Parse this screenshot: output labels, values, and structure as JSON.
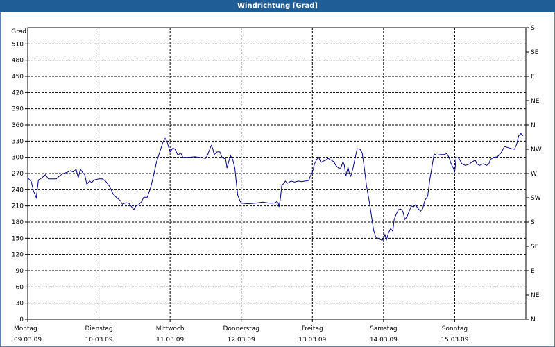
{
  "window": {
    "title": "Windrichtung [Grad]"
  },
  "chart_data": {
    "type": "line",
    "title": "Windrichtung [Grad]",
    "ylabel": "Grad",
    "ylim": [
      0,
      540
    ],
    "yticks": [
      0,
      30,
      60,
      90,
      120,
      150,
      180,
      210,
      240,
      270,
      300,
      330,
      360,
      390,
      420,
      450,
      480,
      510
    ],
    "right_axis_labels": [
      "N",
      "NE",
      "E",
      "SE",
      "S",
      "SW",
      "W",
      "NW",
      "N",
      "NE",
      "E",
      "SE",
      "S"
    ],
    "right_axis_values": [
      0,
      45,
      90,
      135,
      180,
      225,
      270,
      315,
      360,
      405,
      450,
      495,
      540
    ],
    "xlim": [
      0,
      7
    ],
    "x_ticks": [
      {
        "x": 0,
        "day": "Montag",
        "date": "09.03.09"
      },
      {
        "x": 1,
        "day": "Dienstag",
        "date": "10.03.09"
      },
      {
        "x": 2,
        "day": "Mittwoch",
        "date": "11.03.09"
      },
      {
        "x": 3,
        "day": "Donnerstag",
        "date": "12.03.09"
      },
      {
        "x": 4,
        "day": "Freitag",
        "date": "13.03.09"
      },
      {
        "x": 5,
        "day": "Samstag",
        "date": "14.03.09"
      },
      {
        "x": 6,
        "day": "Sonntag",
        "date": "15.03.09"
      }
    ],
    "grid": true,
    "series": [
      {
        "color": "#00008b",
        "points": [
          [
            0.0,
            262
          ],
          [
            0.05,
            255
          ],
          [
            0.08,
            238
          ],
          [
            0.12,
            225
          ],
          [
            0.15,
            258
          ],
          [
            0.2,
            262
          ],
          [
            0.25,
            268
          ],
          [
            0.29,
            260
          ],
          [
            0.35,
            260
          ],
          [
            0.4,
            260
          ],
          [
            0.45,
            266
          ],
          [
            0.5,
            270
          ],
          [
            0.55,
            272
          ],
          [
            0.6,
            275
          ],
          [
            0.64,
            273
          ],
          [
            0.68,
            278
          ],
          [
            0.71,
            262
          ],
          [
            0.74,
            278
          ],
          [
            0.78,
            270
          ],
          [
            0.8,
            268
          ],
          [
            0.83,
            250
          ],
          [
            0.87,
            256
          ],
          [
            0.9,
            253
          ],
          [
            0.93,
            258
          ],
          [
            1.0,
            260
          ],
          [
            1.05,
            260
          ],
          [
            1.1,
            255
          ],
          [
            1.15,
            246
          ],
          [
            1.2,
            232
          ],
          [
            1.25,
            225
          ],
          [
            1.3,
            220
          ],
          [
            1.33,
            213
          ],
          [
            1.38,
            216
          ],
          [
            1.42,
            215
          ],
          [
            1.46,
            208
          ],
          [
            1.49,
            203
          ],
          [
            1.52,
            210
          ],
          [
            1.56,
            212
          ],
          [
            1.6,
            218
          ],
          [
            1.63,
            226
          ],
          [
            1.68,
            226
          ],
          [
            1.73,
            245
          ],
          [
            1.77,
            268
          ],
          [
            1.81,
            292
          ],
          [
            1.86,
            312
          ],
          [
            1.9,
            328
          ],
          [
            1.93,
            335
          ],
          [
            1.96,
            328
          ],
          [
            2.0,
            310
          ],
          [
            2.04,
            317
          ],
          [
            2.07,
            315
          ],
          [
            2.11,
            304
          ],
          [
            2.15,
            308
          ],
          [
            2.18,
            300
          ],
          [
            2.25,
            300
          ],
          [
            2.35,
            301
          ],
          [
            2.45,
            299
          ],
          [
            2.5,
            298
          ],
          [
            2.53,
            305
          ],
          [
            2.56,
            316
          ],
          [
            2.58,
            322
          ],
          [
            2.6,
            316
          ],
          [
            2.62,
            305
          ],
          [
            2.66,
            310
          ],
          [
            2.7,
            310
          ],
          [
            2.73,
            300
          ],
          [
            2.76,
            298
          ],
          [
            2.78,
            298
          ],
          [
            2.8,
            280
          ],
          [
            2.83,
            295
          ],
          [
            2.85,
            303
          ],
          [
            2.88,
            296
          ],
          [
            2.91,
            280
          ],
          [
            2.93,
            255
          ],
          [
            2.95,
            230
          ],
          [
            2.98,
            220
          ],
          [
            3.0,
            215
          ],
          [
            3.1,
            214
          ],
          [
            3.2,
            215
          ],
          [
            3.3,
            217
          ],
          [
            3.4,
            215
          ],
          [
            3.45,
            215
          ],
          [
            3.48,
            216
          ],
          [
            3.5,
            218
          ],
          [
            3.52,
            215
          ],
          [
            3.53,
            208
          ],
          [
            3.55,
            223
          ],
          [
            3.57,
            248
          ],
          [
            3.6,
            252
          ],
          [
            3.62,
            256
          ],
          [
            3.65,
            252
          ],
          [
            3.7,
            256
          ],
          [
            3.75,
            254
          ],
          [
            3.8,
            256
          ],
          [
            3.85,
            255
          ],
          [
            3.9,
            256
          ],
          [
            3.95,
            257
          ],
          [
            3.97,
            265
          ],
          [
            4.0,
            272
          ],
          [
            4.03,
            288
          ],
          [
            4.06,
            296
          ],
          [
            4.09,
            300
          ],
          [
            4.12,
            290
          ],
          [
            4.15,
            293
          ],
          [
            4.18,
            294
          ],
          [
            4.22,
            298
          ],
          [
            4.26,
            295
          ],
          [
            4.3,
            292
          ],
          [
            4.33,
            285
          ],
          [
            4.37,
            280
          ],
          [
            4.4,
            280
          ],
          [
            4.43,
            292
          ],
          [
            4.45,
            285
          ],
          [
            4.47,
            265
          ],
          [
            4.5,
            282
          ],
          [
            4.52,
            270
          ],
          [
            4.54,
            265
          ],
          [
            4.57,
            280
          ],
          [
            4.6,
            298
          ],
          [
            4.63,
            316
          ],
          [
            4.67,
            315
          ],
          [
            4.7,
            308
          ],
          [
            4.73,
            280
          ],
          [
            4.76,
            248
          ],
          [
            4.8,
            218
          ],
          [
            4.83,
            192
          ],
          [
            4.86,
            165
          ],
          [
            4.89,
            152
          ],
          [
            4.92,
            150
          ],
          [
            4.95,
            148
          ],
          [
            4.98,
            146
          ],
          [
            5.0,
            150
          ],
          [
            5.02,
            157
          ],
          [
            5.04,
            147
          ],
          [
            5.07,
            160
          ],
          [
            5.1,
            168
          ],
          [
            5.13,
            163
          ],
          [
            5.15,
            185
          ],
          [
            5.18,
            195
          ],
          [
            5.21,
            203
          ],
          [
            5.24,
            204
          ],
          [
            5.27,
            200
          ],
          [
            5.3,
            185
          ],
          [
            5.33,
            190
          ],
          [
            5.36,
            200
          ],
          [
            5.39,
            210
          ],
          [
            5.42,
            208
          ],
          [
            5.45,
            212
          ],
          [
            5.48,
            206
          ],
          [
            5.52,
            200
          ],
          [
            5.55,
            205
          ],
          [
            5.58,
            220
          ],
          [
            5.62,
            228
          ],
          [
            5.65,
            258
          ],
          [
            5.68,
            282
          ],
          [
            5.71,
            306
          ],
          [
            5.75,
            304
          ],
          [
            5.8,
            305
          ],
          [
            5.85,
            305
          ],
          [
            5.89,
            307
          ],
          [
            5.92,
            300
          ],
          [
            5.95,
            288
          ],
          [
            5.98,
            280
          ],
          [
            6.0,
            272
          ],
          [
            6.02,
            300
          ],
          [
            6.06,
            298
          ],
          [
            6.1,
            288
          ],
          [
            6.15,
            285
          ],
          [
            6.2,
            287
          ],
          [
            6.25,
            292
          ],
          [
            6.29,
            295
          ],
          [
            6.31,
            288
          ],
          [
            6.35,
            285
          ],
          [
            6.4,
            288
          ],
          [
            6.45,
            285
          ],
          [
            6.48,
            288
          ],
          [
            6.5,
            296
          ],
          [
            6.55,
            300
          ],
          [
            6.6,
            301
          ],
          [
            6.65,
            308
          ],
          [
            6.7,
            320
          ],
          [
            6.75,
            318
          ],
          [
            6.8,
            316
          ],
          [
            6.84,
            315
          ],
          [
            6.87,
            324
          ],
          [
            6.9,
            340
          ],
          [
            6.93,
            344
          ],
          [
            6.96,
            340
          ]
        ]
      }
    ]
  }
}
